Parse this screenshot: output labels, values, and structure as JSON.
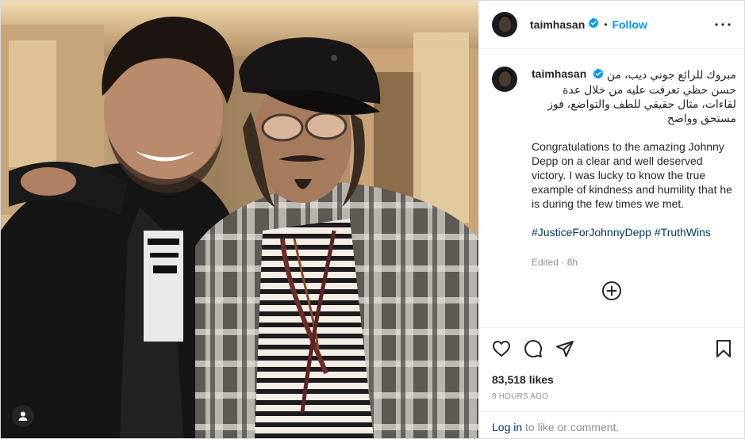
{
  "post": {
    "username": "taimhasan",
    "separator": "•",
    "follow_label": "Follow",
    "caption": {
      "arabic_first_line": "مبروك للرائع جوني ديب، من",
      "arabic_rest": "حسن حظي تعرفت عليه من خلال عدة لقاءات، مثال حقيقي للطف والتواضع، فوز مستحق وواضح",
      "english": "Congratulations to the amazing Johnny Depp on a clear and well deserved victory. I was lucky to know the true example of kindness and humility that he is during the few times we met.",
      "hashtag_1": "#JusticeForJohnnyDepp",
      "hashtag_2": "#TruthWins",
      "edited": "Edited · 8h"
    },
    "likes": "83,518 likes",
    "time": "8 HOURS AGO",
    "login_link": "Log in",
    "login_rest": " to like or comment."
  },
  "colors": {
    "accent": "#0095f6",
    "link": "#00376b",
    "muted": "#8e8e8e",
    "text": "#262626",
    "border": "#dbdbdb"
  },
  "icons": [
    "user-tag-icon",
    "verified-badge-icon",
    "more-options-icon",
    "load-more-comments-icon",
    "heart-icon",
    "comment-icon",
    "share-icon",
    "bookmark-icon"
  ]
}
